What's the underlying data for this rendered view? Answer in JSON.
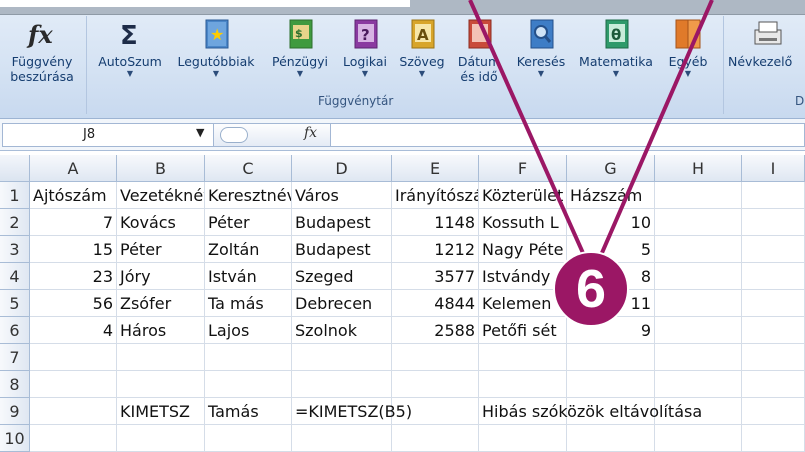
{
  "ribbon": {
    "group_label": "Függvénytár",
    "group_label_partial": "D",
    "buttons": [
      {
        "icon": "function-icon",
        "label1": "Függvény",
        "label2": "beszúrása",
        "has_arrow": false
      },
      {
        "icon": "sigma-icon",
        "label1": "AutoSzum",
        "has_arrow": true
      },
      {
        "icon": "star-book-icon",
        "label1": "Legutóbbiak",
        "has_arrow": true
      },
      {
        "icon": "finance-book-icon",
        "label1": "Pénzügyi",
        "has_arrow": true
      },
      {
        "icon": "question-book-icon",
        "label1": "Logikai",
        "has_arrow": true
      },
      {
        "icon": "text-book-icon",
        "label1": "Szöveg",
        "has_arrow": true
      },
      {
        "icon": "date-book-icon",
        "label1": "Dátum",
        "label2": "és idő",
        "has_arrow": true
      },
      {
        "icon": "lookup-book-icon",
        "label1": "Keresés",
        "has_arrow": true
      },
      {
        "icon": "math-book-icon",
        "label1": "Matematika",
        "has_arrow": true
      },
      {
        "icon": "more-book-icon",
        "label1": "Egyéb",
        "has_arrow": true
      },
      {
        "icon": "name-manager-icon",
        "label1": "Névkezelő",
        "has_arrow": false
      }
    ],
    "colors": {
      "accent": "#153d70",
      "magenta": "#9b1765"
    }
  },
  "formula_bar": {
    "name_box": "J8",
    "fx_label": "fx",
    "formula": ""
  },
  "sheet": {
    "columns": [
      "A",
      "B",
      "C",
      "D",
      "E",
      "F",
      "G",
      "H",
      "I"
    ],
    "rows": [
      "1",
      "2",
      "3",
      "4",
      "5",
      "6",
      "7",
      "8",
      "9",
      "10"
    ],
    "cells": [
      [
        "Ajtószám",
        "Vezetéknév",
        "Keresztnév",
        "Város",
        "Irányítószám",
        "Közterület",
        "Házszám",
        "",
        ""
      ],
      [
        "7",
        "Kovács",
        "Péter",
        "Budapest",
        "1148",
        "Kossuth L",
        "10",
        "",
        ""
      ],
      [
        "15",
        "Péter",
        "Zoltán",
        "Budapest",
        "1212",
        "Nagy Péte",
        "5",
        "",
        ""
      ],
      [
        "23",
        "Jóry",
        "István",
        "Szeged",
        "3577",
        "Istvándy",
        "8",
        "",
        ""
      ],
      [
        "56",
        "Zsófer",
        "Ta más",
        "Debrecen",
        "4844",
        "Kelemen",
        "11",
        "",
        ""
      ],
      [
        "4",
        "Háros",
        "Lajos",
        "Szolnok",
        "2588",
        "Petőfi sét",
        "9",
        "",
        ""
      ],
      [
        "",
        "",
        "",
        "",
        "",
        "",
        "",
        "",
        ""
      ],
      [
        "",
        "",
        "",
        "",
        "",
        "",
        "",
        "",
        ""
      ],
      [
        "",
        "KIMETSZ",
        "Tamás",
        "=KIMETSZ(B5)",
        "",
        "Hibás szóközök eltávolítása",
        "",
        "",
        ""
      ],
      [
        "",
        "",
        "",
        "",
        "",
        "",
        "",
        "",
        ""
      ]
    ]
  },
  "callout": {
    "number": "6"
  }
}
